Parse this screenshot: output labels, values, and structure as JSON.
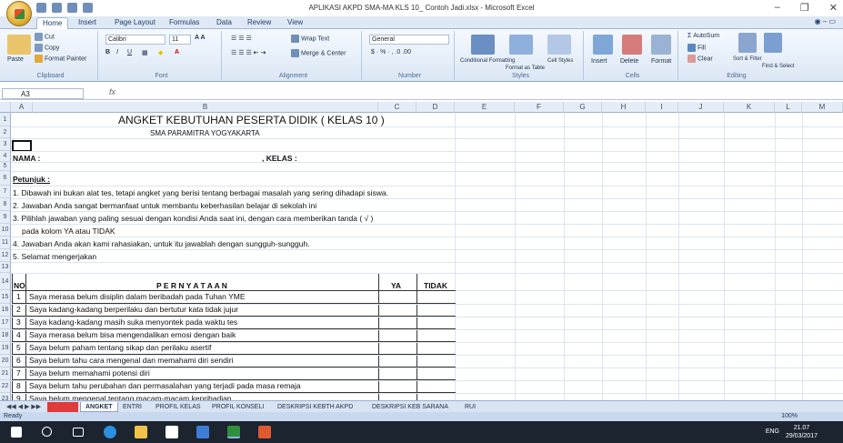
{
  "window": {
    "title": "APLIKASI AKPD SMA-MA  KLS 10_ Contoh Jadi.xlsx - Microsoft Excel",
    "minimize": "–",
    "maximize": "❐",
    "close": "✕"
  },
  "ribbon_tabs": [
    "Home",
    "Insert",
    "Page Layout",
    "Formulas",
    "Data",
    "Review",
    "View"
  ],
  "ribbon": {
    "clipboard": {
      "paste": "Paste",
      "cut": "Cut",
      "copy": "Copy",
      "format_painter": "Format Painter",
      "title": "Clipboard"
    },
    "font": {
      "name": "Calibri",
      "size": "11",
      "title": "Font"
    },
    "alignment": {
      "wrap": "Wrap Text",
      "merge": "Merge & Center",
      "title": "Alignment"
    },
    "number": {
      "format": "General",
      "title": "Number"
    },
    "styles": {
      "conditional": "Conditional Formatting",
      "format_table": "Format as Table",
      "cell_styles": "Cell Styles",
      "title": "Styles"
    },
    "cells": {
      "insert": "Insert",
      "delete": "Delete",
      "format": "Format",
      "title": "Cells"
    },
    "editing": {
      "autosum": "AutoSum",
      "fill": "Fill",
      "clear": "Clear",
      "sort": "Sort & Filter",
      "find": "Find & Select",
      "title": "Editing"
    }
  },
  "formula_bar": {
    "name_box": "A3",
    "fx": "fx",
    "value": ""
  },
  "columns": [
    "A",
    "B",
    "C",
    "D",
    "E",
    "F",
    "G",
    "H",
    "I",
    "J",
    "K",
    "L",
    "M"
  ],
  "rows": [
    "1",
    "2",
    "3",
    "4",
    "5",
    "6",
    "7",
    "8",
    "9",
    "10",
    "11",
    "12",
    "13",
    "14",
    "15",
    "16",
    "17",
    "18",
    "19",
    "20",
    "21",
    "22",
    "23"
  ],
  "sheet": {
    "title": "ANGKET KEBUTUHAN PESERTA DIDIK ( KELAS 10 )",
    "school": "SMA PARAMITRA YOGYAKARTA",
    "nama_label": "NAMA :",
    "kelas_label": ", KELAS :",
    "petunjuk": "Petunjuk :",
    "instructions": [
      "1. Dibawah ini bukan alat tes, tetapi angket yang berisi tentang berbagai masalah yang sering dihadapi siswa.",
      "2. Jawaban Anda sangat bermanfaat  untuk membantu keberhasilan  belajar di sekolah ini",
      "3. Pilihlah jawaban yang paling sesuai dengan kondisi Anda  saat ini, dengan cara memberikan tanda  ( √ )",
      "pada kolom  YA atau TIDAK",
      "4. Jawaban Anda akan kami rahasiakan, untuk itu jawablah dengan sungguh-sungguh.",
      "5. Selamat mengerjakan"
    ],
    "table_headers": {
      "no": "NO",
      "pernyataan": "P E R N Y A T A A N",
      "ya": "YA",
      "tidak": "TIDAK"
    },
    "items": [
      {
        "no": "1",
        "text": "Saya merasa belum disiplin dalam beribadah pada Tuhan YME"
      },
      {
        "no": "2",
        "text": "Saya kadang-kadang berperilaku dan bertutur kata tidak jujur"
      },
      {
        "no": "3",
        "text": "Saya kadang-kadang masih suka menyontek pada waktu tes"
      },
      {
        "no": "4",
        "text": "Saya merasa belum bisa mengendalikan emosi dengan baik"
      },
      {
        "no": "5",
        "text": "Saya belum paham tentang sikap dan perilaku asertif"
      },
      {
        "no": "6",
        "text": "Saya belum tahu cara mengenal dan memahami diri sendiri"
      },
      {
        "no": "7",
        "text": "Saya belum memahami potensi diri"
      },
      {
        "no": "8",
        "text": "Saya belum tahu perubahan dan permasalahan yang terjadi pada masa remaja"
      },
      {
        "no": "9",
        "text": "Saya belum mengenal tentang macam-macam kepribadian"
      }
    ]
  },
  "sheet_tabs": [
    "ANGKET",
    "ENTRI",
    "PROFIL KELAS",
    "PROFIL KONSELI",
    "DESKRIPSI KEBTH AKPD",
    "DESKRIPSI KEB SARANA",
    "RUI"
  ],
  "status": {
    "ready": "Ready",
    "zoom": "100%"
  },
  "taskbar": {
    "lang": "ENG",
    "time": "21.07",
    "date": "29/03/2017"
  }
}
